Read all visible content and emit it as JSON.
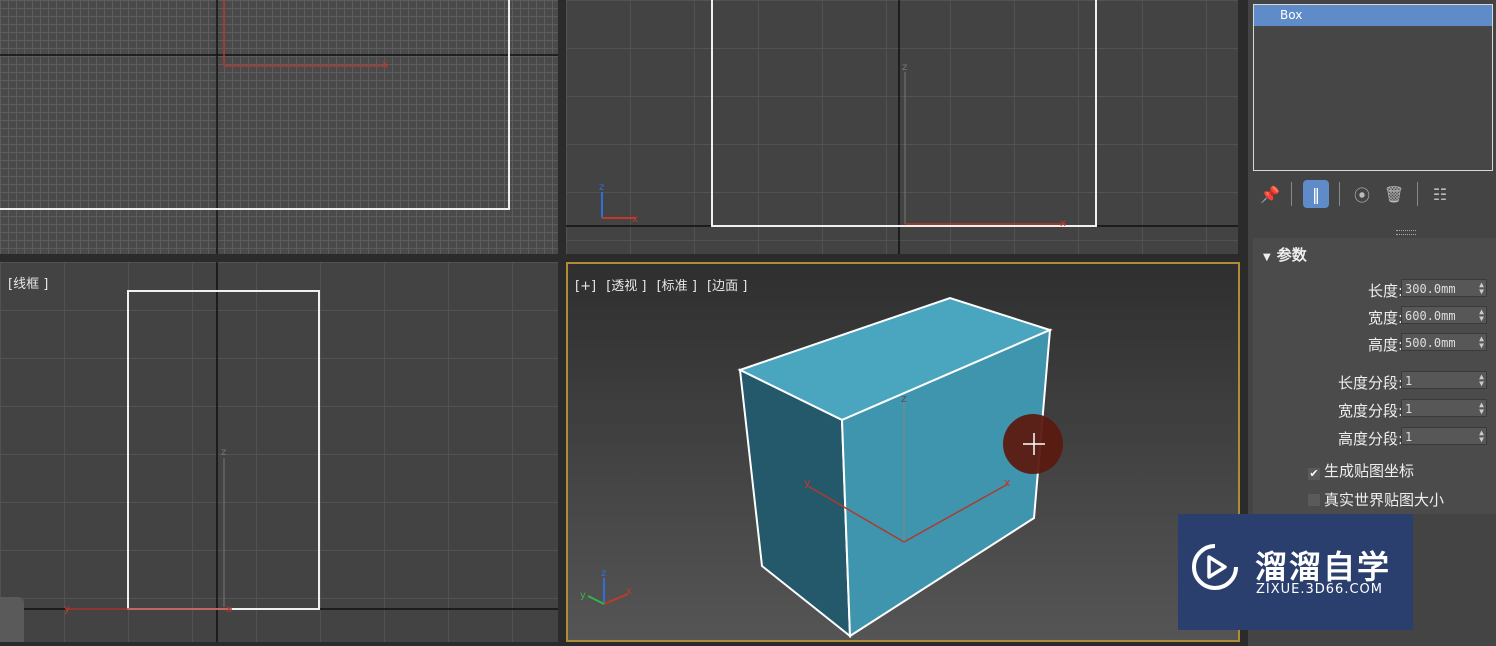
{
  "viewports": {
    "left_label": "[线框 ]",
    "perspective_labels": [
      "[+]",
      "[透视 ]",
      "[标准 ]",
      "[边面 ]"
    ],
    "axis": {
      "x": "x",
      "y": "y",
      "z": "z"
    }
  },
  "modifier_stack": {
    "items": [
      "Box"
    ]
  },
  "toolbar": {
    "icons": [
      "pin-icon",
      "show-end-result-icon",
      "make-unique-icon",
      "remove-modifier-icon",
      "configure-sets-icon"
    ]
  },
  "parameters": {
    "title": "参数",
    "fields": [
      {
        "label": "长度:",
        "value": "300.0mm"
      },
      {
        "label": "宽度:",
        "value": "600.0mm"
      },
      {
        "label": "高度:",
        "value": "500.0mm"
      },
      {
        "label": "长度分段:",
        "value": "1"
      },
      {
        "label": "宽度分段:",
        "value": "1"
      },
      {
        "label": "高度分段:",
        "value": "1"
      }
    ],
    "checkboxes": [
      {
        "label": "生成贴图坐标",
        "checked": true
      },
      {
        "label": "真实世界贴图大小",
        "checked": false
      }
    ]
  },
  "watermark": {
    "title": "溜溜自学",
    "subtitle": "ZIXUE.3D66.COM"
  },
  "colors": {
    "selection": "#5f8bc9",
    "box_face": "#4aa6bf",
    "active_border": "#b08c3a",
    "axis_x": "#c0392b"
  }
}
